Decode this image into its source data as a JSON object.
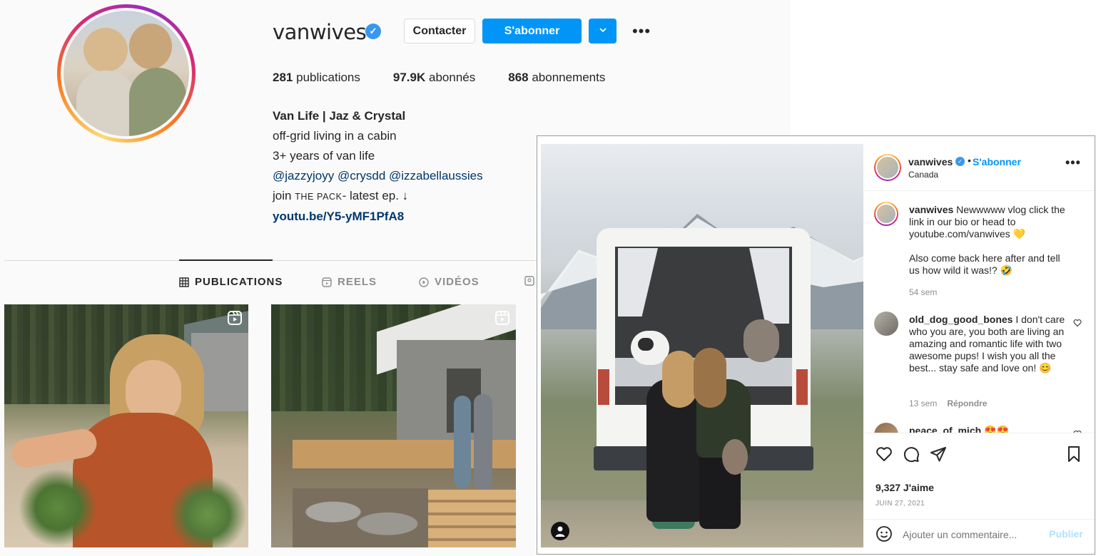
{
  "profile": {
    "username": "vanwives",
    "verified_glyph": "✓",
    "contact_label": "Contacter",
    "follow_label": "S'abonner",
    "more_label": "•••",
    "stats": {
      "posts_count": "281",
      "posts_label": "publications",
      "followers_count": "97.9K",
      "followers_label": "abonnés",
      "following_count": "868",
      "following_label": "abonnements"
    },
    "bio": {
      "name": "Van Life | Jaz & Crystal",
      "line1": "off-grid living in a cabin",
      "line2": "3+ years of van life",
      "mentions": "@jazzyjoyy @crysdd @izzabellaussies",
      "line4_prefix": "join ",
      "line4_caps": "THE PACK",
      "line4_suffix": "- latest ep. ↓",
      "link": "youtu.be/Y5-yMF1PfA8"
    },
    "tabs": [
      {
        "label": "PUBLICATIONS",
        "icon": "grid-icon",
        "active": true
      },
      {
        "label": "REELS",
        "icon": "reels-icon",
        "active": false
      },
      {
        "label": "VIDÉOS",
        "icon": "video-icon",
        "active": false
      }
    ]
  },
  "post": {
    "header": {
      "username": "vanwives",
      "dot": "•",
      "follow_label": "S'abonner",
      "location": "Canada",
      "more_label": "•••"
    },
    "caption": {
      "username": "vanwives",
      "text1": " Newwwww vlog click the link in our bio or head to youtube.com/vanwives 💛",
      "text2": "Also come back here after and tell us how wild it was!? 🤣",
      "time": "54 sem"
    },
    "comments": [
      {
        "username": "old_dog_good_bones",
        "text": " I don't care who you are, you both are living an amazing and romantic life with two awesome pups! I wish you all the best... stay safe and love on! 😊",
        "time": "13 sem",
        "reply_label": "Répondre"
      },
      {
        "username": "peace_of_mich",
        "text": " 😍😍"
      }
    ],
    "likes": "9,327 J'aime",
    "date": "JUIN 27, 2021",
    "add_comment_placeholder": "Ajouter un commentaire...",
    "publish_label": "Publier"
  },
  "colors": {
    "accent_blue": "#0095f6",
    "link_blue": "#00376b",
    "text_primary": "#262626",
    "text_secondary": "#8e8e8e"
  }
}
